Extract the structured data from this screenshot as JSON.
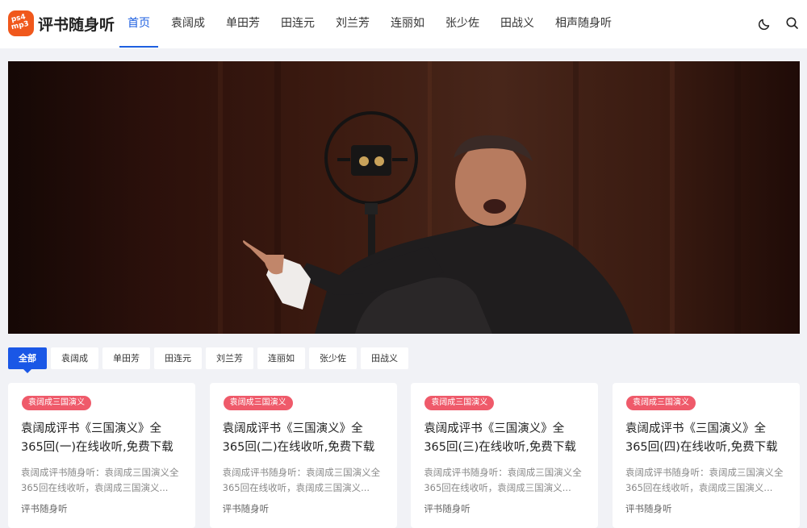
{
  "site": {
    "logo_badge_line1": "ps4",
    "logo_badge_line2": "mp3",
    "logo_text": "评书随身听"
  },
  "nav": {
    "items": [
      {
        "label": "首页",
        "active": true
      },
      {
        "label": "袁阔成"
      },
      {
        "label": "单田芳"
      },
      {
        "label": "田连元"
      },
      {
        "label": "刘兰芳"
      },
      {
        "label": "连丽如"
      },
      {
        "label": "张少佐"
      },
      {
        "label": "田战义"
      },
      {
        "label": "相声随身听"
      }
    ]
  },
  "header_icons": [
    "moon-icon",
    "search-icon"
  ],
  "filters": {
    "items": [
      "全部",
      "袁阔成",
      "单田芳",
      "田连元",
      "刘兰芳",
      "连丽如",
      "张少佐",
      "田战义"
    ],
    "active_index": 0
  },
  "cards": [
    {
      "tag": "袁阔成三国演义",
      "title": "袁阔成评书《三国演义》全365回(一)在线收听,免费下载",
      "excerpt": "袁阔成评书随身听：袁阔成三国演义全365回在线收听，袁阔成三国演义...",
      "meta": "评书随身听"
    },
    {
      "tag": "袁阔成三国演义",
      "title": "袁阔成评书《三国演义》全365回(二)在线收听,免费下载",
      "excerpt": "袁阔成评书随身听：袁阔成三国演义全365回在线收听，袁阔成三国演义...",
      "meta": "评书随身听"
    },
    {
      "tag": "袁阔成三国演义",
      "title": "袁阔成评书《三国演义》全365回(三)在线收听,免费下载",
      "excerpt": "袁阔成评书随身听：袁阔成三国演义全365回在线收听，袁阔成三国演义...",
      "meta": "评书随身听"
    },
    {
      "tag": "袁阔成三国演义",
      "title": "袁阔成评书《三国演义》全365回(四)在线收听,免费下载",
      "excerpt": "袁阔成评书随身听：袁阔成三国演义全365回在线收听，袁阔成三国演义...",
      "meta": "评书随身听"
    }
  ],
  "colors": {
    "accent": "#1d5fe0",
    "tag": "#ef5a6a",
    "logo": "#f0581c"
  }
}
